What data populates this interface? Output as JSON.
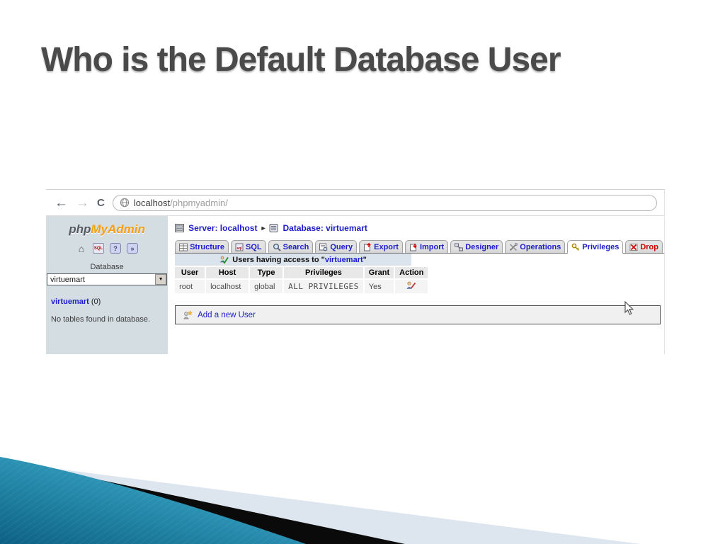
{
  "slide": {
    "title": "Who is the Default Database User"
  },
  "browser": {
    "reload_label": "C",
    "url": {
      "host": "localhost",
      "path": "/phpmyadmin/"
    }
  },
  "icons": {
    "back_arrow": "←",
    "forward_arrow": "→",
    "breadcrumb_arrow": "▸",
    "dropdown_arrow": "▼",
    "home": "⌂",
    "sql_window": "SQL",
    "help_bubble": "?",
    "docs_bubble": "»"
  },
  "phpmyadmin": {
    "logo": {
      "php": "php",
      "myadmin": "MyAdmin"
    },
    "sidebar": {
      "database_label": "Database",
      "selected_database": "virtuemart",
      "database_link": "virtuemart",
      "table_count": "(0)",
      "empty_message": "No tables found in database."
    },
    "breadcrumb": {
      "server": "Server: localhost",
      "database": "Database: virtuemart"
    },
    "active_tab": "Privileges",
    "tabs": [
      {
        "label": "Structure"
      },
      {
        "label": "SQL"
      },
      {
        "label": "Search"
      },
      {
        "label": "Query"
      },
      {
        "label": "Export"
      },
      {
        "label": "Import"
      },
      {
        "label": "Designer"
      },
      {
        "label": "Operations"
      },
      {
        "label": "Privileges"
      },
      {
        "label": "Drop"
      }
    ],
    "users": {
      "caption_prefix": "Users having access to \"",
      "caption_database": "virtuemart",
      "caption_suffix": "\"",
      "table": {
        "headers": [
          "User",
          "Host",
          "Type",
          "Privileges",
          "Grant",
          "Action"
        ],
        "rows": [
          {
            "user": "root",
            "host": "localhost",
            "type": "global",
            "privileges": "ALL PRIVILEGES",
            "grant": "Yes"
          }
        ]
      },
      "add_user_label": "Add a new User"
    }
  },
  "colors": {
    "link_blue": "#1c1ccd",
    "drop_red": "#cc0000",
    "logo_orange": "#f79e16",
    "sidebar_bg": "#d3dde2",
    "caption_bg": "#dbe3ec",
    "teal_dark": "#0c6183",
    "teal_light": "#49b2d2",
    "decor_gray": "#dde6ee",
    "decor_black": "#0a0a0a"
  }
}
